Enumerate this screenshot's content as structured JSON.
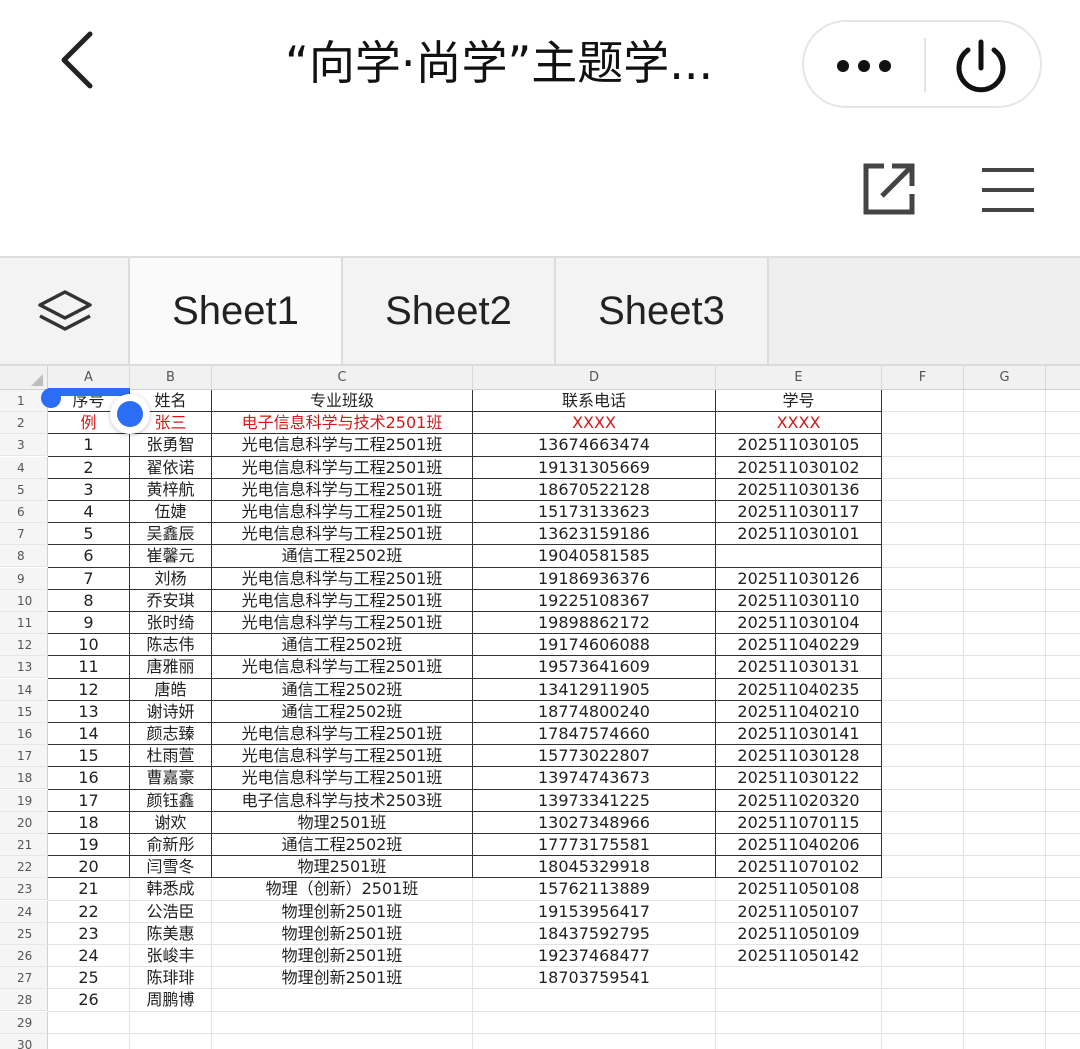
{
  "nav": {
    "title": "“向学·尚学”主题学...",
    "back_icon": "chevron-left-icon",
    "more_icon": "more-dots-icon",
    "power_icon": "power-icon"
  },
  "toolbar": {
    "share_icon": "share-external-icon",
    "menu_icon": "hamburger-menu-icon"
  },
  "tabs": {
    "layers_icon": "layers-icon",
    "items": [
      "Sheet1",
      "Sheet2",
      "Sheet3"
    ],
    "active": 0
  },
  "sheet": {
    "columns": [
      "A",
      "B",
      "C",
      "D",
      "E",
      "F",
      "G"
    ],
    "row_numbers": [
      "1",
      "2",
      "3",
      "4",
      "5",
      "6",
      "7",
      "8",
      "9",
      "10",
      "11",
      "12",
      "13",
      "14",
      "15",
      "16",
      "17",
      "18",
      "19",
      "20",
      "21",
      "22",
      "23",
      "24",
      "25",
      "26",
      "27",
      "28",
      "29",
      "30"
    ],
    "rows": [
      [
        "序号",
        "姓名",
        "专业班级",
        "联系电话",
        "学号"
      ],
      [
        "例",
        "张三",
        "电子信息科学与技术2501班",
        "XXXX",
        "XXXX"
      ],
      [
        "1",
        "张勇智",
        "光电信息科学与工程2501班",
        "13674663474",
        "202511030105"
      ],
      [
        "2",
        "翟依诺",
        "光电信息科学与工程2501班",
        "19131305669",
        "202511030102"
      ],
      [
        "3",
        "黄梓航",
        "光电信息科学与工程2501班",
        "18670522128",
        "202511030136"
      ],
      [
        "4",
        "伍婕",
        "光电信息科学与工程2501班",
        "15173133623",
        "202511030117"
      ],
      [
        "5",
        "吴鑫辰",
        "光电信息科学与工程2501班",
        "13623159186",
        "202511030101"
      ],
      [
        "6",
        "崔馨元",
        "通信工程2502班",
        "19040581585",
        ""
      ],
      [
        "7",
        "刘杨",
        "光电信息科学与工程2501班",
        "19186936376",
        "202511030126"
      ],
      [
        "8",
        "乔安琪",
        "光电信息科学与工程2501班",
        "19225108367",
        "202511030110"
      ],
      [
        "9",
        "张时绮",
        "光电信息科学与工程2501班",
        "19898862172",
        "202511030104"
      ],
      [
        "10",
        "陈志伟",
        "通信工程2502班",
        "19174606088",
        "202511040229"
      ],
      [
        "11",
        "唐雅丽",
        "光电信息科学与工程2501班",
        "19573641609",
        "202511030131"
      ],
      [
        "12",
        "唐皓",
        "通信工程2502班",
        "13412911905",
        "202511040235"
      ],
      [
        "13",
        "谢诗妍",
        "通信工程2502班",
        "18774800240",
        "202511040210"
      ],
      [
        "14",
        "颜志臻",
        "光电信息科学与工程2501班",
        "17847574660",
        "202511030141"
      ],
      [
        "15",
        "杜雨萱",
        "光电信息科学与工程2501班",
        "15773022807",
        "202511030128"
      ],
      [
        "16",
        "曹嘉豪",
        "光电信息科学与工程2501班",
        "13974743673",
        "202511030122"
      ],
      [
        "17",
        "颜钰鑫",
        "电子信息科学与技术2503班",
        "13973341225",
        "202511020320"
      ],
      [
        "18",
        "谢欢",
        "物理2501班",
        "13027348966",
        "202511070115"
      ],
      [
        "19",
        "俞新彤",
        "通信工程2502班",
        "17773175581",
        "202511040206"
      ],
      [
        "20",
        "闫雪冬",
        "物理2501班",
        "18045329918",
        "202511070102"
      ],
      [
        "21",
        "韩悉成",
        "物理（创新）2501班",
        "15762113889",
        "202511050108"
      ],
      [
        "22",
        "公浩臣",
        "物理创新2501班",
        "19153956417",
        "202511050107"
      ],
      [
        "23",
        "陈美惠",
        "物理创新2501班",
        "18437592795",
        "202511050109"
      ],
      [
        "24",
        "张峻丰",
        "物理创新2501班",
        "19237468477",
        "202511050142"
      ],
      [
        "25",
        "陈琲琲",
        "物理创新2501班",
        "18703759541",
        ""
      ],
      [
        "26",
        "周鹏博",
        "",
        "",
        ""
      ],
      [
        "",
        "",
        "",
        "",
        ""
      ],
      [
        "",
        "",
        "",
        "",
        ""
      ]
    ],
    "bordered_rows": 22,
    "example_row_color": "#d11a1a",
    "selection_color": "#2b6ef5"
  }
}
